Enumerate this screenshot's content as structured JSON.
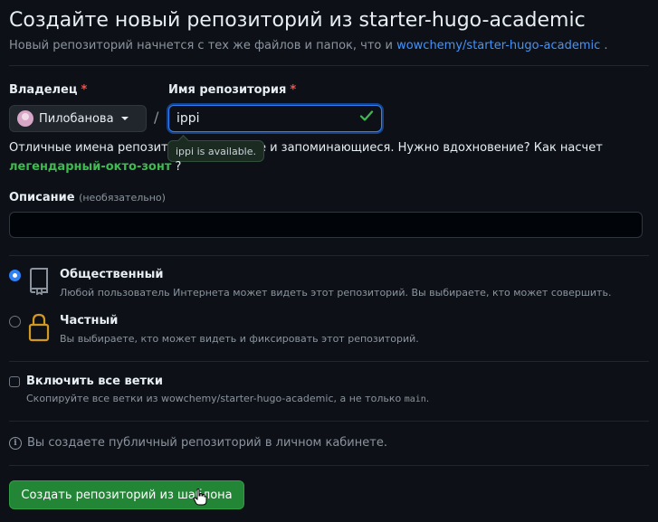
{
  "header": {
    "title": "Создайте новый репозиторий из starter-hugo-academic",
    "subtitle_prefix": "Новый репозиторий начнется с тех же файлов и папок, что и",
    "template_link": "wowchemy/starter-hugo-academic",
    "subtitle_suffix": "."
  },
  "owner": {
    "label": "Владелец",
    "required_mark": "*",
    "selected": "Пилобанова"
  },
  "repo_name": {
    "label": "Имя репозитория",
    "required_mark": "*",
    "value": "ippi",
    "separator": "/",
    "tooltip": "ippi is available."
  },
  "hint": {
    "text": "Отличные имена репозиториев короткие и запоминающиеся. Нужно вдохновение? Как насчет",
    "suggestion": "легендарный-окто-зонт",
    "suffix": "?"
  },
  "description": {
    "label": "Описание",
    "optional": "(необязательно)",
    "value": ""
  },
  "visibility": {
    "public": {
      "title": "Общественный",
      "desc": "Любой пользователь Интернета может видеть этот репозиторий. Вы выбираете, кто может совершить.",
      "checked": true
    },
    "private": {
      "title": "Частный",
      "desc": "Вы выбираете, кто может видеть и фиксировать этот репозиторий.",
      "checked": false
    }
  },
  "branches": {
    "title": "Включить все ветки",
    "desc_prefix": "Скопируйте все ветки из wowchemy/starter-hugo-academic, а не только",
    "desc_code": "main",
    "desc_suffix": "."
  },
  "notice": {
    "text": "Вы создаете публичный репозиторий в личном кабинете."
  },
  "submit": {
    "label": "Создать репозиторий из шаблона"
  },
  "colors": {
    "background": "#0d1117",
    "accent": "#2f81f7",
    "success": "#238636",
    "danger": "#f85149"
  }
}
